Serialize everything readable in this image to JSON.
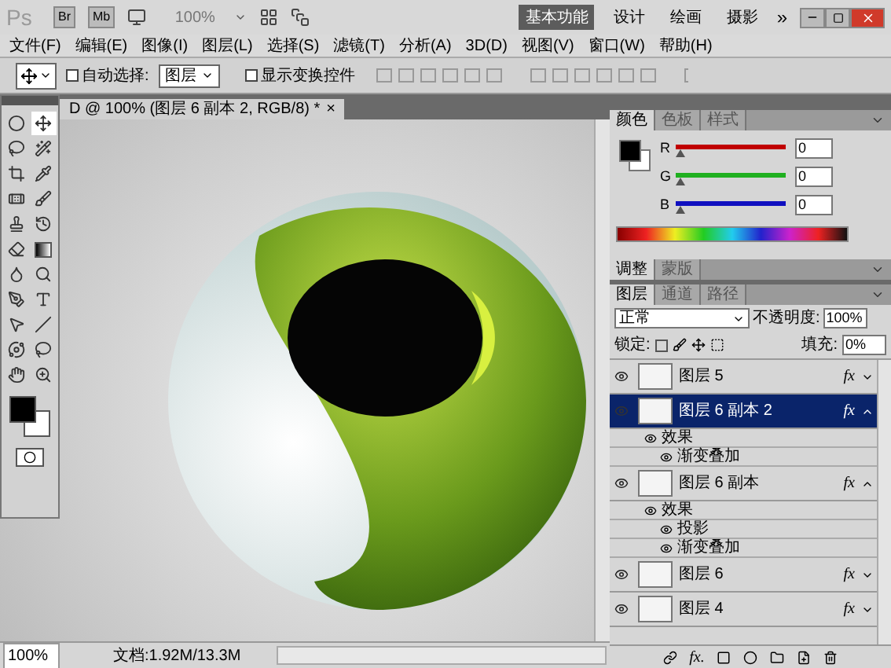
{
  "app_bar": {
    "logo": "Ps",
    "bridge": "Br",
    "mini_bridge": "Mb",
    "zoom": "100%",
    "more": "»",
    "workspaces": [
      {
        "label": "基本功能",
        "selected": true
      },
      {
        "label": "设计",
        "selected": false
      },
      {
        "label": "绘画",
        "selected": false
      },
      {
        "label": "摄影",
        "selected": false
      }
    ]
  },
  "menu": [
    "文件(F)",
    "编辑(E)",
    "图像(I)",
    "图层(L)",
    "选择(S)",
    "滤镜(T)",
    "分析(A)",
    "3D(D)",
    "视图(V)",
    "窗口(W)",
    "帮助(H)"
  ],
  "options_bar": {
    "auto_select": {
      "label": "自动选择:",
      "checked": false
    },
    "auto_select_target": "图层",
    "show_transform": {
      "label": "显示变换控件",
      "checked": false
    }
  },
  "document": {
    "tab": "D @ 100% (图层 6 副本 2, RGB/8) *",
    "close": "×"
  },
  "status_bar": {
    "zoom": "100%",
    "doc_info": "文档:1.92M/13.3M"
  },
  "color_panel": {
    "tabs": [
      {
        "label": "颜色",
        "selected": true
      },
      {
        "label": "色板",
        "selected": false
      },
      {
        "label": "样式",
        "selected": false
      }
    ],
    "sliders": [
      {
        "label": "R",
        "color": "#c00000",
        "level": 0,
        "value": "0"
      },
      {
        "label": "G",
        "color": "#20b020",
        "level": 0,
        "value": "0"
      },
      {
        "label": "B",
        "color": "#1010c0",
        "level": 0,
        "value": "0"
      }
    ]
  },
  "adjust_panel": {
    "tabs": [
      {
        "label": "调整",
        "selected": true
      },
      {
        "label": "蒙版",
        "selected": false
      }
    ]
  },
  "layers_panel": {
    "tabs": [
      {
        "label": "图层",
        "selected": true
      },
      {
        "label": "通道",
        "selected": false
      },
      {
        "label": "路径",
        "selected": false
      }
    ],
    "blend_mode": "正常",
    "opacity_label": "不透明度:",
    "opacity": "100%",
    "lock_label": "锁定:",
    "fill_label": "填充:",
    "fill": "0%",
    "footer_fx": "fx.",
    "layers": [
      {
        "name": "图层 5",
        "fx": "fx",
        "visible": true,
        "selected": false,
        "expanded": false
      },
      {
        "name": "图层 6 副本 2",
        "fx": "fx",
        "visible": true,
        "selected": true,
        "expanded": true,
        "effects_label": "效果",
        "effects": [
          "渐变叠加"
        ]
      },
      {
        "name": "图层 6 副本",
        "fx": "fx",
        "visible": true,
        "selected": false,
        "expanded": true,
        "effects_label": "效果",
        "effects": [
          "投影",
          "渐变叠加"
        ]
      },
      {
        "name": "图层 6",
        "fx": "fx",
        "visible": true,
        "selected": false,
        "expanded": false
      },
      {
        "name": "图层 4",
        "fx": "fx",
        "visible": true,
        "selected": false,
        "expanded": false
      }
    ]
  }
}
